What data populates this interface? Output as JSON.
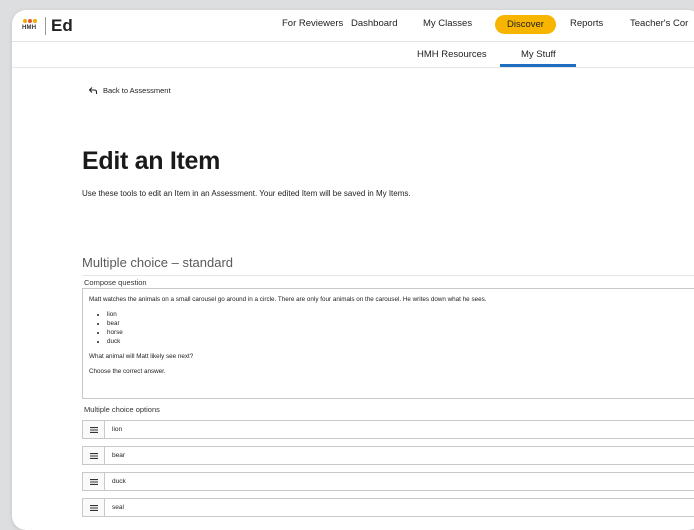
{
  "header": {
    "logo_text": "HMH",
    "app_name": "Ed",
    "nav": [
      {
        "label": "For Reviewers"
      },
      {
        "label": "Dashboard"
      },
      {
        "label": "My Classes"
      },
      {
        "label": "Discover",
        "active": true
      },
      {
        "label": "Reports"
      },
      {
        "label": "Teacher's Cor"
      }
    ],
    "accent_color": "#f7b500"
  },
  "subnav": {
    "items": [
      {
        "label": "HMH Resources"
      },
      {
        "label": "My Stuff",
        "active": true
      }
    ],
    "underline_color": "#1f6ec1"
  },
  "back_link": "Back to Assessment",
  "page": {
    "title": "Edit an Item",
    "description": "Use these tools to edit an Item in an Assessment. Your edited Item will be saved in My Items.",
    "section_title": "Multiple choice – standard"
  },
  "compose": {
    "label": "Compose question",
    "intro": "Matt watches the animals on a small carousel go around in a circle. There are only four animals on the carousel. He writes down what he sees.",
    "list": [
      "lion",
      "bear",
      "horse",
      "duck"
    ],
    "question": "What animal will Matt likely see next?",
    "instruction": "Choose the correct answer."
  },
  "options": {
    "label": "Multiple choice options",
    "items": [
      "lion",
      "bear",
      "duck",
      "seal"
    ]
  }
}
